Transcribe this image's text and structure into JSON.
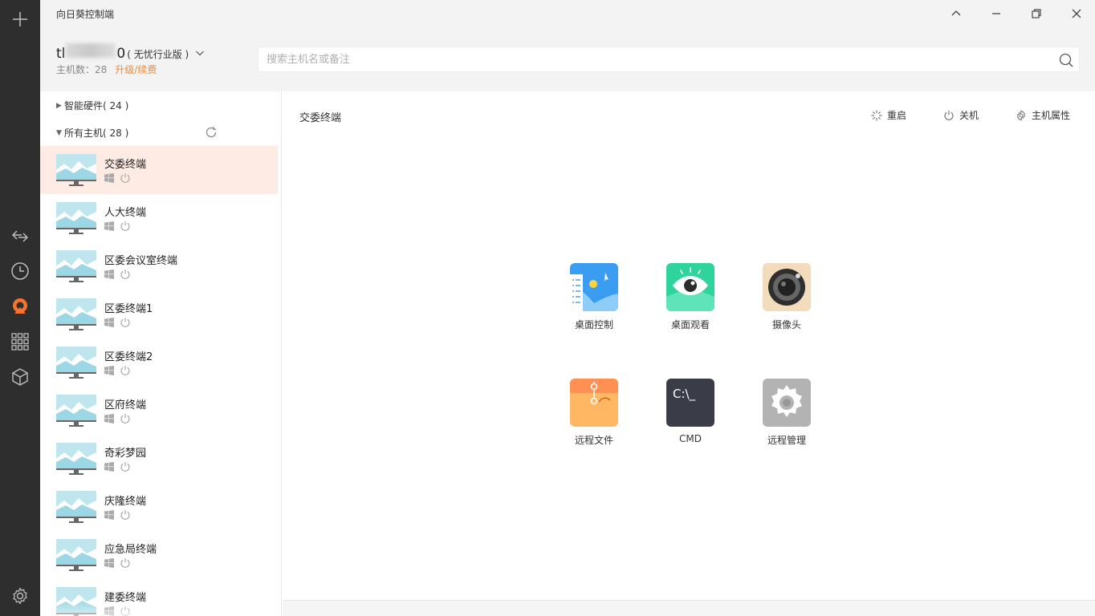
{
  "app": {
    "title": "向日葵控制端"
  },
  "account": {
    "name_prefix": "tl",
    "name_suffix": "0",
    "edition": "( 无忧行业版 )",
    "host_count": "主机数：28",
    "upgrade": "升级/续费"
  },
  "search": {
    "placeholder": "搜索主机名或备注"
  },
  "groups": {
    "smart_hw": "智能硬件( 24 )",
    "all_hosts": "所有主机( 28 )"
  },
  "hosts": [
    {
      "name": "交委终端"
    },
    {
      "name": "人大终端"
    },
    {
      "name": "区委会议室终端"
    },
    {
      "name": "区委终端1"
    },
    {
      "name": "区委终端2"
    },
    {
      "name": "区府终端"
    },
    {
      "name": "奇彩梦园"
    },
    {
      "name": "庆隆终端"
    },
    {
      "name": "应急局终端"
    },
    {
      "name": "建委终端"
    }
  ],
  "detail": {
    "title": "交委终端",
    "actions": {
      "restart": "重启",
      "shutdown": "关机",
      "properties": "主机属性"
    },
    "apps": {
      "desktop_control": "桌面控制",
      "desktop_view": "桌面观看",
      "camera": "摄像头",
      "remote_file": "远程文件",
      "cmd": "CMD",
      "cmd_glyph": "C:\\_",
      "remote_manage": "远程管理"
    }
  },
  "colors": {
    "rail": "#2e2e2e",
    "accent": "#f08a3a",
    "selected_row": "#fdebe4",
    "header_bg": "#f3f3f3"
  }
}
